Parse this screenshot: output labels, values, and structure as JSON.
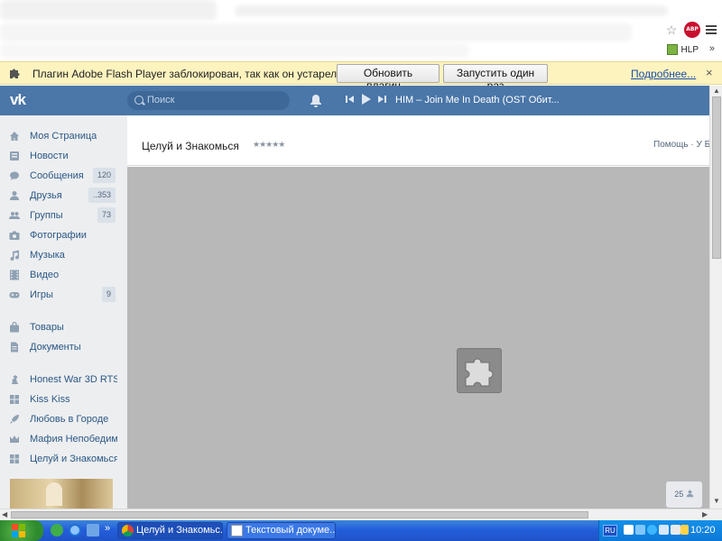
{
  "plugin_bar": {
    "message": "Плагин Adobe Flash Player заблокирован, так как он устарел.",
    "update_button": "Обновить плагин...",
    "run_once_button": "Запустить один раз",
    "more_link": "Подробнее...",
    "close": "×"
  },
  "browser": {
    "extensions": {
      "hlp_label": "HLP",
      "abp_label": "ABP"
    },
    "overflow": "»"
  },
  "header": {
    "logo": "vk",
    "search_placeholder": "Поиск",
    "track": "HIM – Join Me In Death (OST Обит..."
  },
  "sidebar": {
    "items": [
      {
        "label": "Моя Страница",
        "icon": "home-icon"
      },
      {
        "label": "Новости",
        "icon": "news-icon"
      },
      {
        "label": "Сообщения",
        "icon": "messages-icon",
        "count": "120"
      },
      {
        "label": "Друзья",
        "icon": "friends-icon",
        "count": "..353"
      },
      {
        "label": "Группы",
        "icon": "groups-icon",
        "count": "73"
      },
      {
        "label": "Фотографии",
        "icon": "camera-icon"
      },
      {
        "label": "Музыка",
        "icon": "music-icon"
      },
      {
        "label": "Видео",
        "icon": "video-icon"
      },
      {
        "label": "Игры",
        "icon": "gamepad-icon",
        "count": "9"
      },
      {
        "label": "Товары",
        "icon": "bag-icon"
      },
      {
        "label": "Документы",
        "icon": "document-icon"
      },
      {
        "label": "Honest War 3D RTS",
        "icon": "chess-icon"
      },
      {
        "label": "Kiss Kiss",
        "icon": "grid-icon"
      },
      {
        "label": "Любовь в Городе",
        "icon": "rocket-icon"
      },
      {
        "label": "Мафия Непобедим...",
        "icon": "crown-icon"
      },
      {
        "label": "Целуй и Знакомься",
        "icon": "grid-icon"
      }
    ]
  },
  "app": {
    "title": "Целуй и Знакомься",
    "rating": "★★★★★",
    "help": "Помощь · У Б",
    "online_count": "25"
  },
  "taskbar": {
    "tasks": [
      {
        "label": "Целуй и Знакомьс...",
        "active": true
      },
      {
        "label": "Текстовый докуме...",
        "active": false
      }
    ],
    "lang": "RU",
    "clock": "10:20"
  },
  "colors": {
    "vk_blue": "#4a76a8",
    "plugin_bar": "#fdf3bf",
    "link": "#2a5885"
  }
}
